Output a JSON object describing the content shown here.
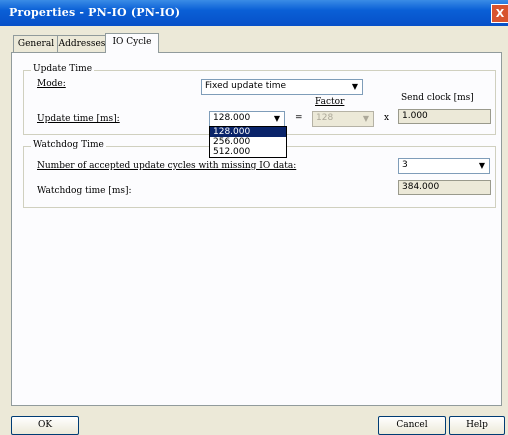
{
  "window": {
    "title": "Properties - PN-IO (PN-IO)",
    "close_label": "X"
  },
  "tabs": [
    {
      "label": "General"
    },
    {
      "label": "Addresses"
    },
    {
      "label": "IO Cycle"
    }
  ],
  "update_time_group": {
    "title": "Update Time",
    "mode_label": "Mode:",
    "mode_value": "Fixed update time",
    "update_time_label": "Update time [ms]:",
    "update_time_value": "128.000",
    "equals": "=",
    "factor_label": "Factor",
    "factor_value": "128",
    "times": "x",
    "send_clock_label": "Send clock [ms]",
    "send_clock_value": "1.000",
    "dropdown_options": [
      "128.000",
      "256.000",
      "512.000"
    ]
  },
  "watchdog_group": {
    "title": "Watchdog Time",
    "cycles_label": "Number of accepted update cycles with missing IO data:",
    "cycles_value": "3",
    "watchdog_label": "Watchdog time [ms]:",
    "watchdog_value": "384.000"
  },
  "buttons": {
    "ok": "OK",
    "cancel": "Cancel",
    "help": "Help"
  }
}
